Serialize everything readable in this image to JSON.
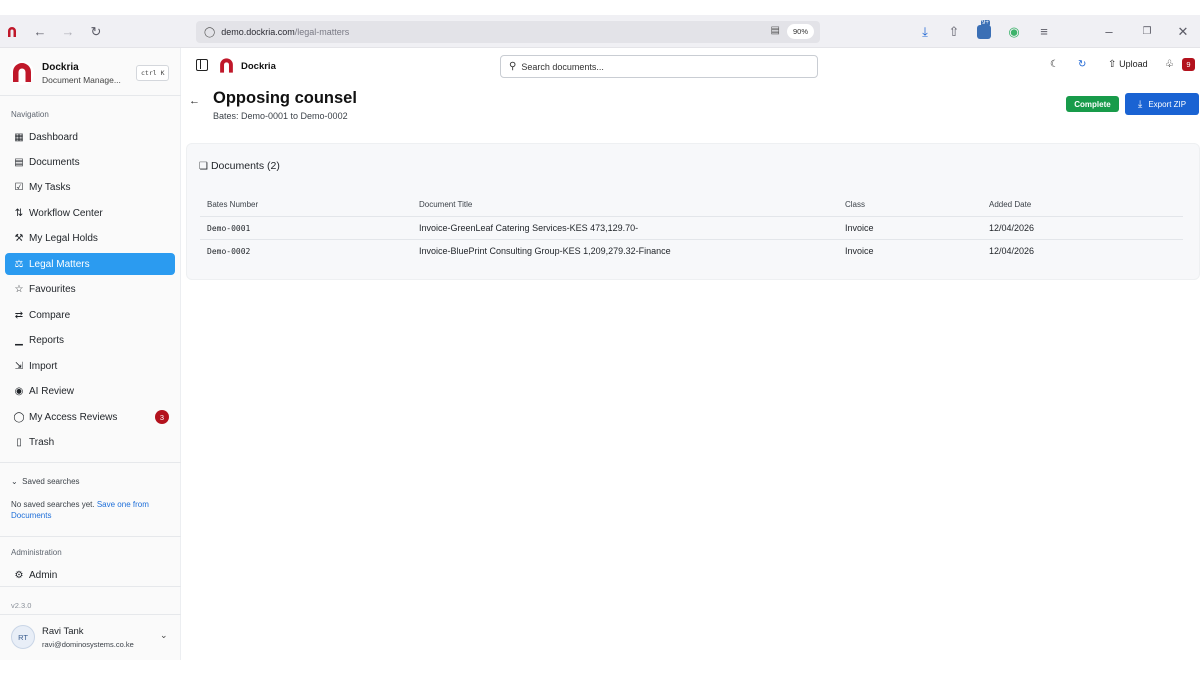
{
  "browser": {
    "url_host": "demo.dockria.com",
    "url_path": "/legal-matters",
    "zoom": "90%",
    "ext_badge": "9+"
  },
  "sidebar": {
    "brand_name": "Dockria",
    "brand_sub": "Document Manage...",
    "shortcut": "ctrl K",
    "nav_section": "Navigation",
    "items": [
      {
        "label": "Dashboard",
        "icon": "dashboard-icon"
      },
      {
        "label": "Documents",
        "icon": "document-icon"
      },
      {
        "label": "My Tasks",
        "icon": "tasks-icon"
      },
      {
        "label": "Workflow Center",
        "icon": "workflow-icon"
      },
      {
        "label": "My Legal Holds",
        "icon": "gavel-icon"
      },
      {
        "label": "Legal Matters",
        "icon": "scale-icon"
      },
      {
        "label": "Favourites",
        "icon": "star-icon"
      },
      {
        "label": "Compare",
        "icon": "compare-icon"
      },
      {
        "label": "Reports",
        "icon": "chart-icon"
      },
      {
        "label": "Import",
        "icon": "import-icon"
      },
      {
        "label": "AI Review",
        "icon": "ai-icon"
      },
      {
        "label": "My Access Reviews",
        "icon": "shield-icon",
        "badge": "3"
      },
      {
        "label": "Trash",
        "icon": "trash-icon"
      }
    ],
    "saved_label": "Saved searches",
    "saved_empty": "No saved searches yet.",
    "saved_link": "Save one from Documents",
    "admin_section": "Administration",
    "admin_item": "Admin",
    "version": "v2.3.0",
    "user": {
      "initials": "RT",
      "name": "Ravi Tank",
      "email": "ravi@dominosystems.co.ke"
    }
  },
  "header": {
    "app_name": "Dockria",
    "search_placeholder": "Search documents...",
    "upload_label": "Upload",
    "notif_count": "9"
  },
  "page": {
    "title": "Opposing counsel",
    "subtitle": "Bates: Demo-0001 to Demo-0002",
    "complete_label": "Complete",
    "export_label": "Export ZIP"
  },
  "documents": {
    "heading": "Documents (2)",
    "columns": [
      "Bates Number",
      "Document Title",
      "Class",
      "Added Date"
    ],
    "rows": [
      [
        "Demo-0001",
        "Invoice-GreenLeaf Catering Services-KES 473,129.70-",
        "Invoice",
        "12/04/2026"
      ],
      [
        "Demo-0002",
        "Invoice-BluePrint Consulting Group-KES 1,209,279.32-Finance",
        "Invoice",
        "12/04/2026"
      ]
    ]
  },
  "colors": {
    "accent": "#2b9bf0",
    "complete": "#189b4a",
    "export": "#1a63d3",
    "badge": "#b3121d",
    "brand": "#c0182a"
  }
}
